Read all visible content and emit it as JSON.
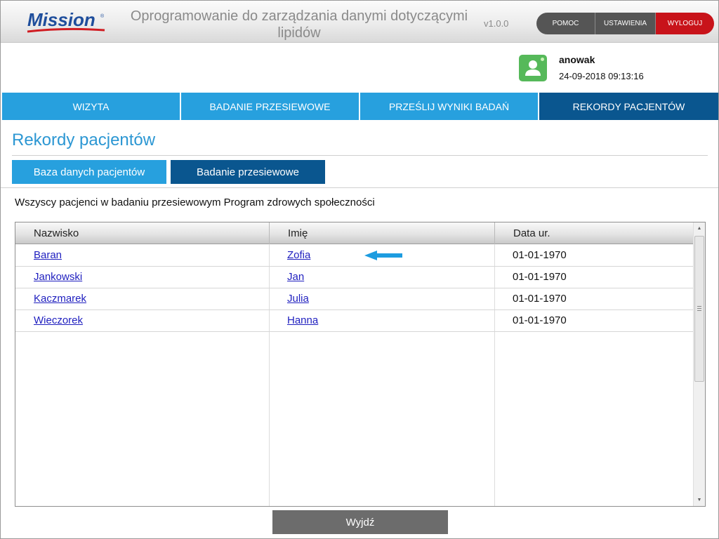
{
  "header": {
    "logo_text": "Mission",
    "title": "Oprogramowanie do zarządzania danymi dotyczącymi lipidów",
    "version": "v1.0.0",
    "help_label": "POMOC",
    "settings_label": "USTAWIENIA",
    "logout_label": "WYLOGUJ"
  },
  "user": {
    "name": "anowak",
    "datetime": "24-09-2018 09:13:16"
  },
  "nav": {
    "items": [
      {
        "label": "WIZYTA"
      },
      {
        "label": "BADANIE PRZESIEWOWE"
      },
      {
        "label": "PRZEŚLIJ WYNIKI BADAŃ"
      },
      {
        "label": "REKORDY PACJENTÓW"
      }
    ]
  },
  "page": {
    "title": "Rekordy pacjentów",
    "subtabs": [
      {
        "label": "Baza danych pacjentów"
      },
      {
        "label": "Badanie przesiewowe"
      }
    ],
    "description": "Wszyscy pacjenci w badaniu przesiewowym Program zdrowych społeczności"
  },
  "table": {
    "columns": [
      "Nazwisko",
      "Imię",
      "Data ur."
    ],
    "rows": [
      {
        "last": "Baran",
        "first": "Zofia",
        "dob": "01-01-1970"
      },
      {
        "last": "Jankowski",
        "first": "Jan",
        "dob": "01-01-1970"
      },
      {
        "last": "Kaczmarek",
        "first": "Julia",
        "dob": "01-01-1970"
      },
      {
        "last": "Wieczorek",
        "first": "Hanna",
        "dob": "01-01-1970"
      }
    ]
  },
  "footer": {
    "exit_label": "Wyjdź"
  },
  "colors": {
    "nav_blue": "#27a0de",
    "nav_active": "#0a568f",
    "logout_red": "#c8131a",
    "title_blue": "#2c97d3",
    "avatar_green": "#56b95a"
  },
  "icons": {
    "avatar": "user-avatar-icon",
    "pointer": "left-arrow-icon"
  }
}
